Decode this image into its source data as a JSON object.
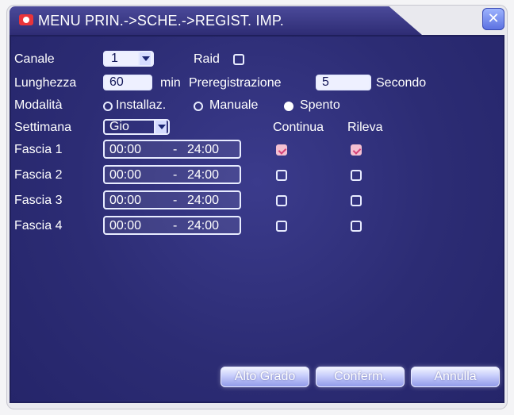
{
  "window": {
    "title": "MENU PRIN.->SCHE.->REGIST. IMP.",
    "close_symbol": "✕"
  },
  "form": {
    "canale_label": "Canale",
    "canale_value": "1",
    "raid_label": "Raid",
    "lunghezza_label": "Lunghezza",
    "lunghezza_value": "60",
    "min_unit": "min",
    "preregistrazione_label": "Preregistrazione",
    "preregistrazione_value": "5",
    "secondo_unit": "Secondo",
    "modalita_label": "Modalità",
    "modalita_options": [
      "Installaz.",
      "Manuale",
      "Spento"
    ],
    "modalita_selected": "Spento",
    "settimana_label": "Settimana",
    "settimana_value": "Gio",
    "continua_label": "Continua",
    "rileva_label": "Rileva"
  },
  "fasce": [
    {
      "label": "Fascia 1",
      "start": "00:00",
      "sep": "-",
      "end": "24:00",
      "continua": true,
      "rileva": true
    },
    {
      "label": "Fascia 2",
      "start": "00:00",
      "sep": "-",
      "end": "24:00",
      "continua": false,
      "rileva": false
    },
    {
      "label": "Fascia 3",
      "start": "00:00",
      "sep": "-",
      "end": "24:00",
      "continua": false,
      "rileva": false
    },
    {
      "label": "Fascia 4",
      "start": "00:00",
      "sep": "-",
      "end": "24:00",
      "continua": false,
      "rileva": false
    }
  ],
  "buttons": {
    "alto_grado": "Alto Grado",
    "conferm": "Conferm.",
    "annulla": "Annulla"
  },
  "icons": {
    "title": "record-icon",
    "close": "close-icon",
    "dropdown": "chevron-down-icon"
  }
}
